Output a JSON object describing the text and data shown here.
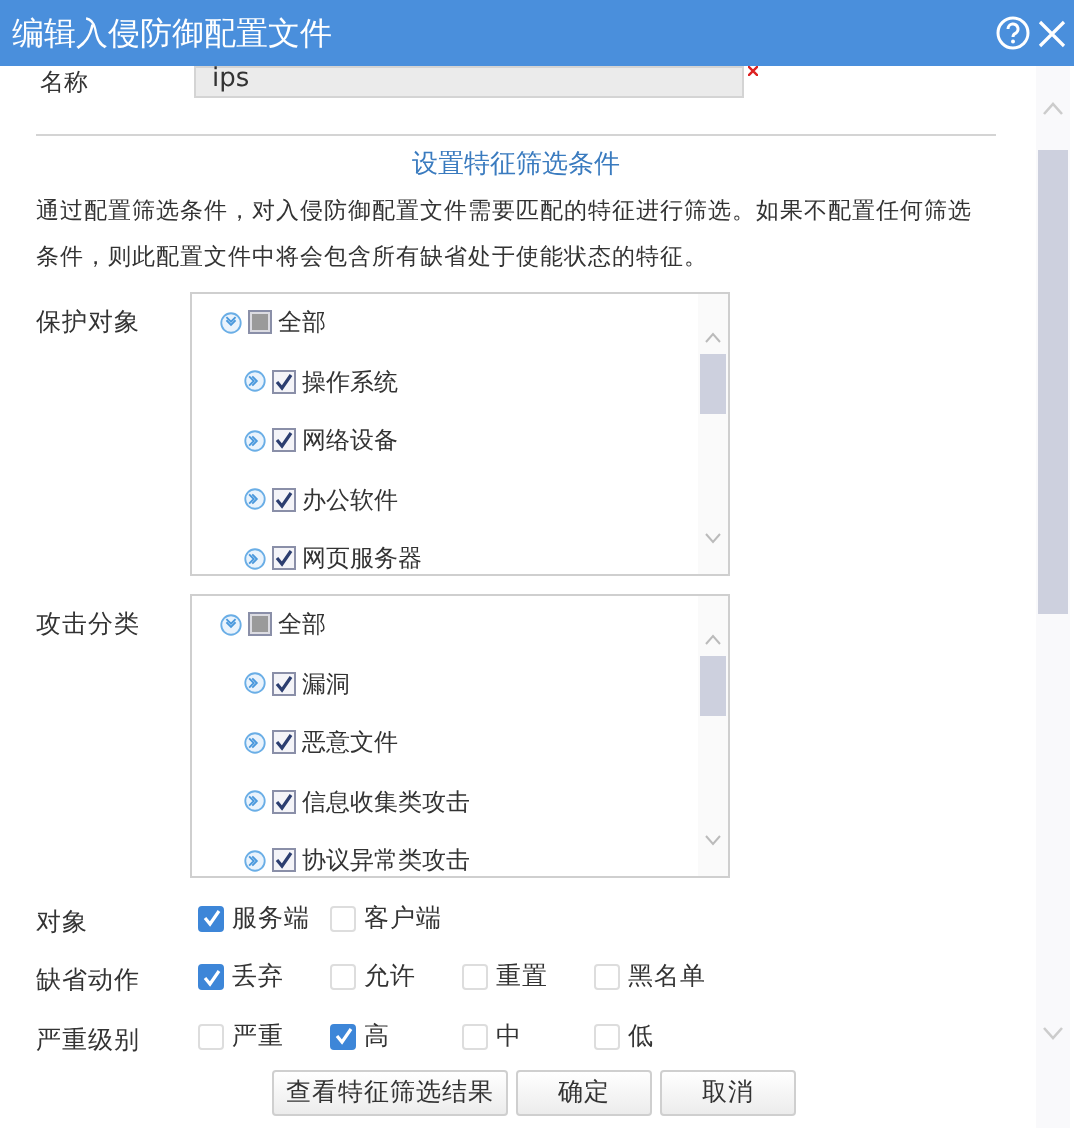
{
  "window": {
    "title": "编辑入侵防御配置文件"
  },
  "name_row": {
    "label": "名称",
    "value": "ips"
  },
  "section_title": "设置特征筛选条件",
  "description": "通过配置筛选条件，对入侵防御配置文件需要匹配的特征进行筛选。如果不配置任何筛选条件，则此配置文件中将会包含所有缺省处于使能状态的特征。",
  "trees": [
    {
      "label": "保护对象",
      "items": [
        {
          "label": "全部",
          "checked": false,
          "partial": true,
          "expanded": true,
          "children": [
            {
              "label": "操作系统",
              "checked": true,
              "expanded": false
            },
            {
              "label": "网络设备",
              "checked": true,
              "expanded": false
            },
            {
              "label": "办公软件",
              "checked": true,
              "expanded": false
            },
            {
              "label": "网页服务器",
              "checked": true,
              "expanded": false
            }
          ]
        }
      ]
    },
    {
      "label": "攻击分类",
      "items": [
        {
          "label": "全部",
          "checked": false,
          "partial": true,
          "expanded": true,
          "children": [
            {
              "label": "漏洞",
              "checked": true,
              "expanded": false
            },
            {
              "label": "恶意文件",
              "checked": true,
              "expanded": false
            },
            {
              "label": "信息收集类攻击",
              "checked": true,
              "expanded": false
            },
            {
              "label": "协议异常类攻击",
              "checked": true,
              "expanded": false
            }
          ]
        }
      ]
    }
  ],
  "option_rows": [
    {
      "label": "对象",
      "options": [
        {
          "label": "服务端",
          "checked": true
        },
        {
          "label": "客户端",
          "checked": false
        }
      ]
    },
    {
      "label": "缺省动作",
      "options": [
        {
          "label": "丢弃",
          "checked": true
        },
        {
          "label": "允许",
          "checked": false
        },
        {
          "label": "重置",
          "checked": false
        },
        {
          "label": "黑名单",
          "checked": false
        }
      ]
    },
    {
      "label": "严重级别",
      "options": [
        {
          "label": "严重",
          "checked": false
        },
        {
          "label": "高",
          "checked": true
        },
        {
          "label": "中",
          "checked": false
        },
        {
          "label": "低",
          "checked": false
        }
      ]
    }
  ],
  "buttons": [
    "查看特征筛选结果",
    "确定",
    "取消"
  ]
}
